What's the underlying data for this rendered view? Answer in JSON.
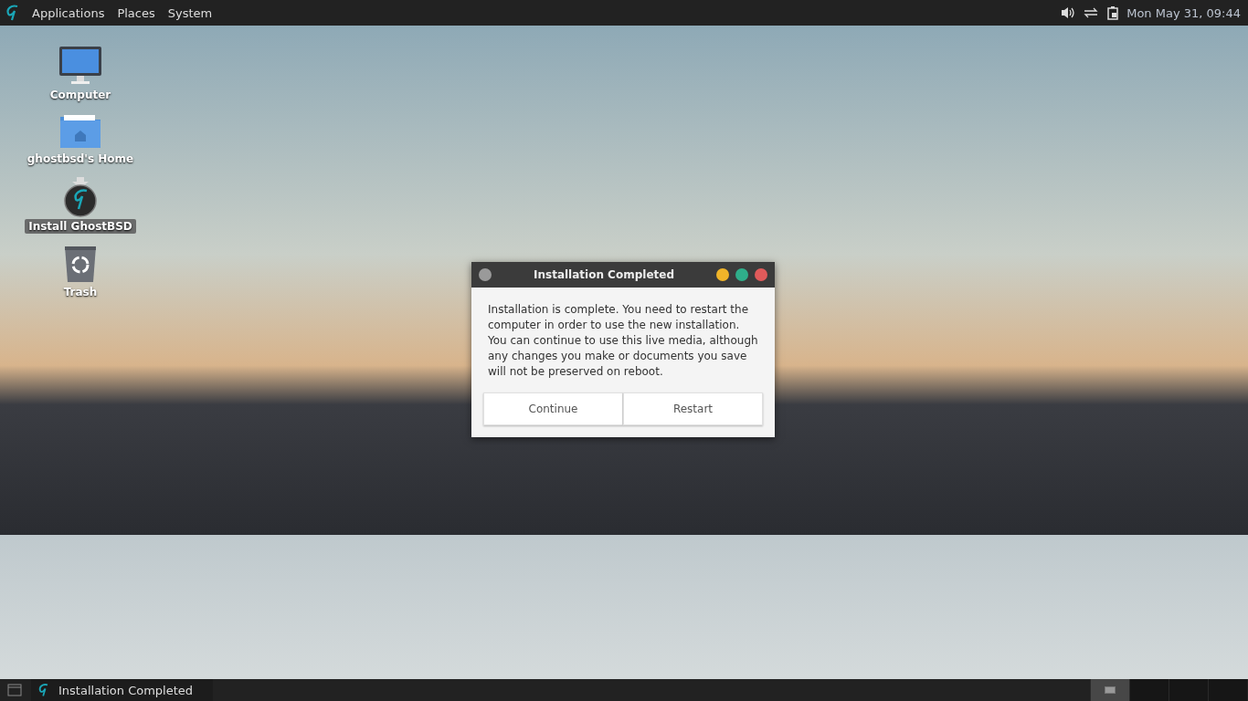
{
  "top_panel": {
    "menus": [
      "Applications",
      "Places",
      "System"
    ],
    "clock": "Mon May 31, 09:44"
  },
  "desktop_icons": [
    {
      "kind": "computer",
      "label": "Computer",
      "selected": false
    },
    {
      "kind": "home",
      "label": "ghostbsd's Home",
      "selected": false
    },
    {
      "kind": "installer",
      "label": "Install GhostBSD",
      "selected": true
    },
    {
      "kind": "trash",
      "label": "Trash",
      "selected": false
    }
  ],
  "dialog": {
    "title": "Installation Completed",
    "message": "Installation is complete. You need to restart the computer in order to use the new installation. You can continue to use this live media, although any changes you make or documents you save will not be preserved on reboot.",
    "buttons": [
      "Continue",
      "Restart"
    ]
  },
  "bottom_panel": {
    "tasks": [
      {
        "label": "Installation Completed",
        "selected": false
      }
    ],
    "workspaces": [
      {
        "selected": true
      },
      {
        "selected": false
      },
      {
        "selected": false
      },
      {
        "selected": false
      }
    ]
  }
}
